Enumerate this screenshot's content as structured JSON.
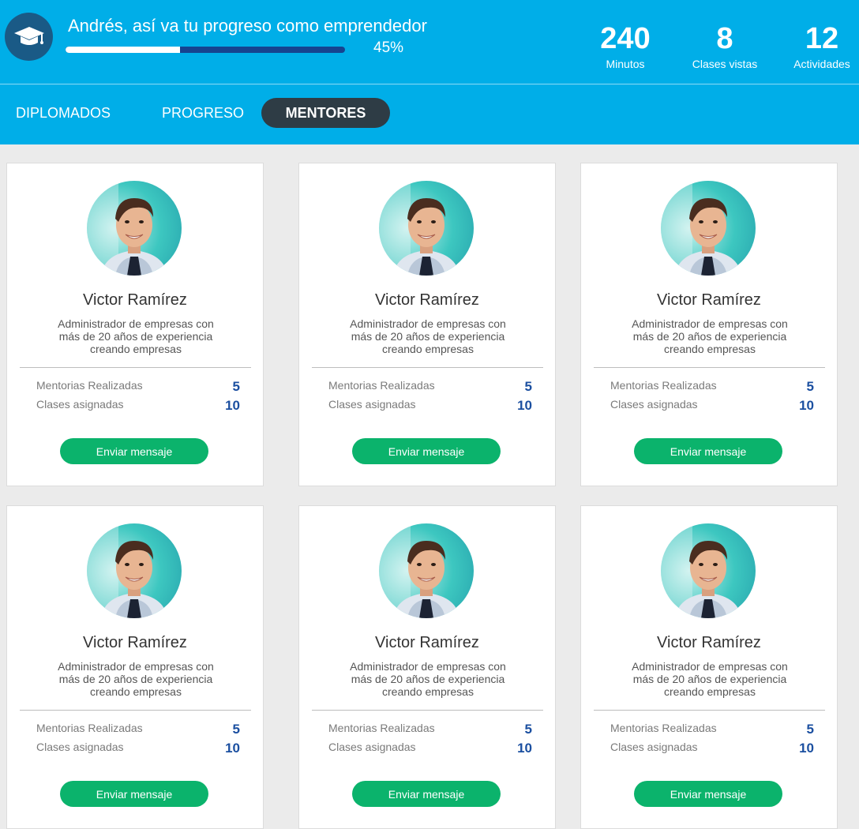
{
  "header": {
    "title": "Andrés, así va tu progreso como emprendedor",
    "progress_label": "45%",
    "progress_value": 0.41,
    "stats": [
      {
        "value": "240",
        "label": "Minutos"
      },
      {
        "value": "8",
        "label": "Clases vistas"
      },
      {
        "value": "12",
        "label": "Actividades"
      }
    ]
  },
  "tabs": [
    {
      "label": "DIPLOMADOS"
    },
    {
      "label": "PROGRESO"
    },
    {
      "label": "MENTORES"
    }
  ],
  "mentors": [
    {
      "name": "Victor Ramírez",
      "desc": "Administrador de empresas con más de 20 años de experiencia creando empresas",
      "mentorias_label": "Mentorias Realizadas",
      "mentorias_value": "5",
      "clases_label": "Clases asignadas",
      "clases_value": "10",
      "button": "Enviar mensaje"
    },
    {
      "name": "Victor Ramírez",
      "desc": "Administrador de empresas con más de 20 años de experiencia creando empresas",
      "mentorias_label": "Mentorias Realizadas",
      "mentorias_value": "5",
      "clases_label": "Clases asignadas",
      "clases_value": "10",
      "button": "Enviar mensaje"
    },
    {
      "name": "Victor Ramírez",
      "desc": "Administrador de empresas con más de 20 años de experiencia creando empresas",
      "mentorias_label": "Mentorias Realizadas",
      "mentorias_value": "5",
      "clases_label": "Clases asignadas",
      "clases_value": "10",
      "button": "Enviar mensaje"
    },
    {
      "name": "Victor Ramírez",
      "desc": "Administrador de empresas con más de 20 años de experiencia creando empresas",
      "mentorias_label": "Mentorias Realizadas",
      "mentorias_value": "5",
      "clases_label": "Clases asignadas",
      "clases_value": "10",
      "button": "Enviar mensaje"
    },
    {
      "name": "Victor Ramírez",
      "desc": "Administrador de empresas con más de 20 años de experiencia creando empresas",
      "mentorias_label": "Mentorias Realizadas",
      "mentorias_value": "5",
      "clases_label": "Clases asignadas",
      "clases_value": "10",
      "button": "Enviar mensaje"
    },
    {
      "name": "Victor Ramírez",
      "desc": "Administrador de empresas con más de 20 años de experiencia creando empresas",
      "mentorias_label": "Mentorias Realizadas",
      "mentorias_value": "5",
      "clases_label": "Clases asignadas",
      "clases_value": "10",
      "button": "Enviar mensaje"
    }
  ],
  "icons": {
    "header_badge": "graduation-cap-icon"
  },
  "colors": {
    "header_bg": "#00aee8",
    "active_tab_bg": "#2e3c45",
    "button_green": "#0bb36c",
    "stat_value_blue": "#1b4fa0"
  }
}
